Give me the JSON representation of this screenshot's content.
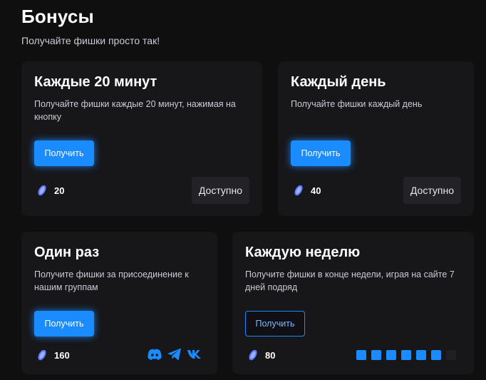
{
  "header": {
    "title": "Бонусы",
    "subtitle": "Получайте фишки просто так!"
  },
  "cards": [
    {
      "title": "Каждые 20 минут",
      "description": "Получайте фишки каждые 20 минут, нажимая на кнопку",
      "button_label": "Получить",
      "reward": "20",
      "status": "Доступно"
    },
    {
      "title": "Каждый день",
      "description": "Получайте фишки каждый день",
      "button_label": "Получить",
      "reward": "40",
      "status": "Доступно"
    },
    {
      "title": "Один раз",
      "description": "Получите фишки за присоединение к нашим группам",
      "button_label": "Получить",
      "reward": "160",
      "socials": [
        "discord-icon",
        "telegram-icon",
        "vk-icon"
      ]
    },
    {
      "title": "Каждую неделю",
      "description": "Получите фишки в конце недели, играя на сайте 7 дней подряд",
      "button_label": "Получить",
      "reward": "80",
      "streak": {
        "days_completed": 6,
        "days_total": 7
      }
    }
  ],
  "colors": {
    "background": "#0f0f10",
    "card": "#17171a",
    "accent": "#1a8cff",
    "coin": "#5b7cff",
    "status_bg": "#222227"
  }
}
